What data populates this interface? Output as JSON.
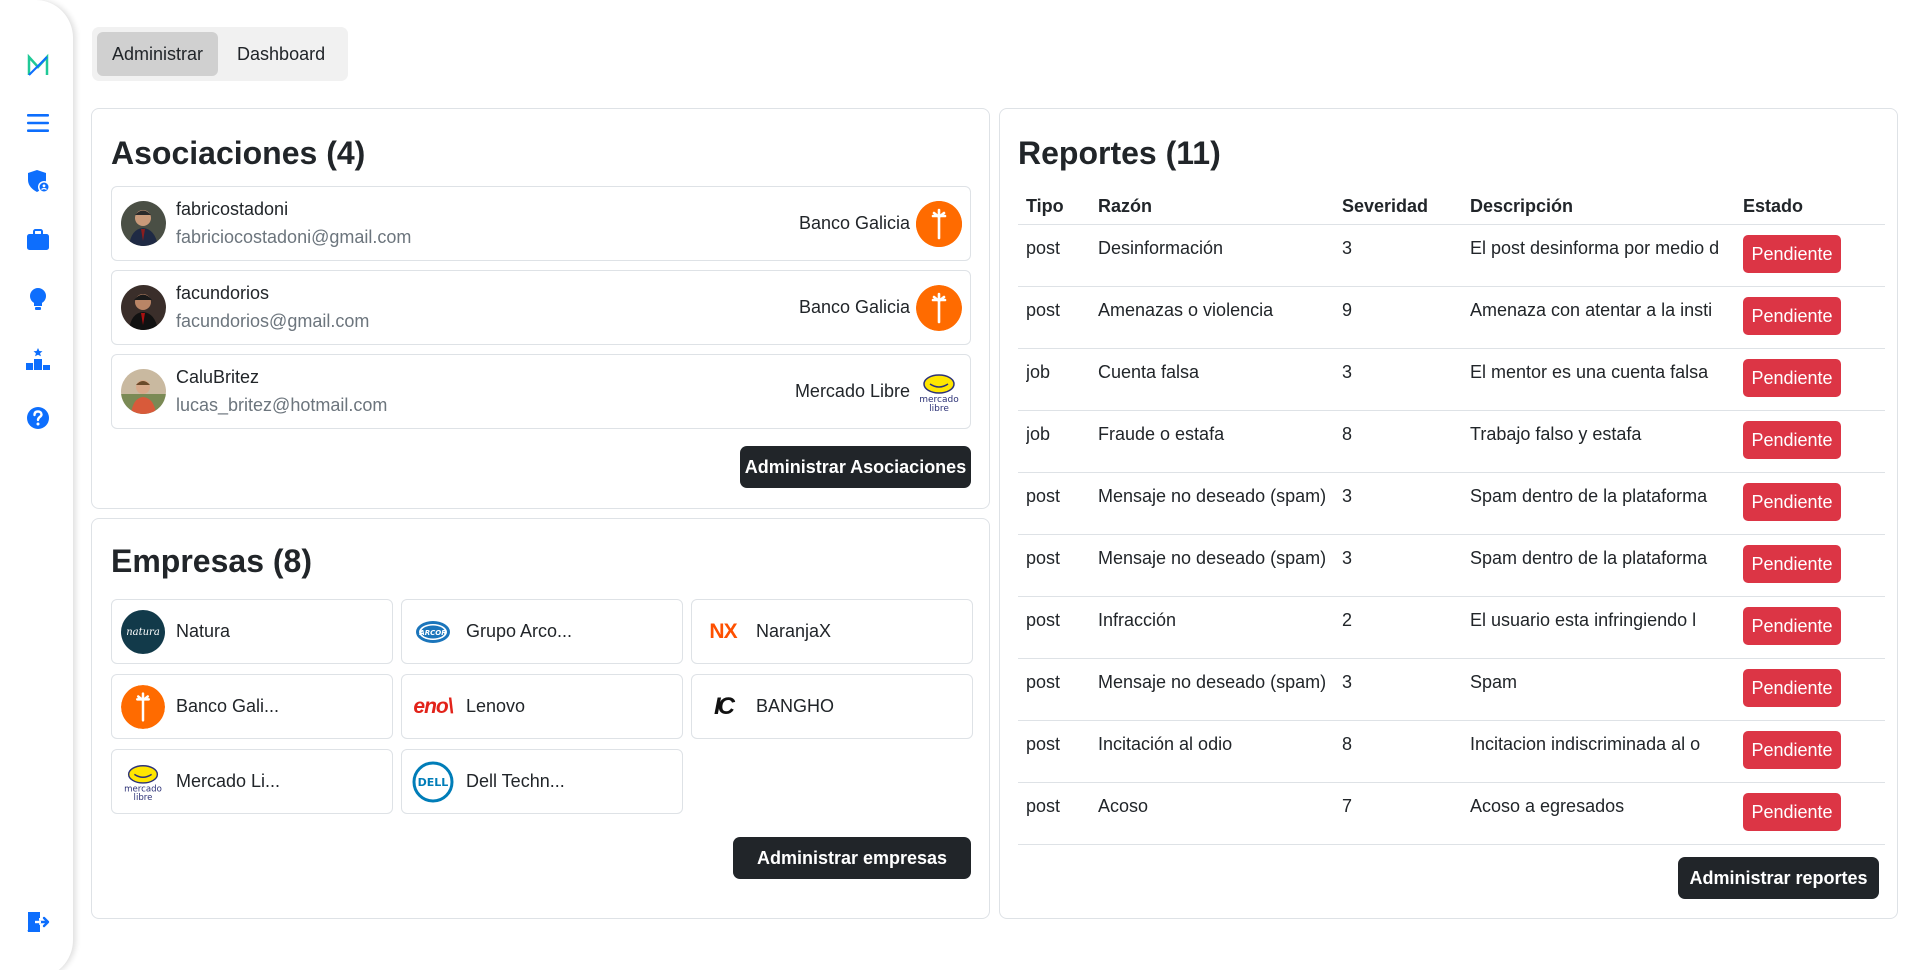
{
  "sidebar": {
    "icons": [
      "logo-icon",
      "menu-icon",
      "shield-user-icon",
      "briefcase-icon",
      "lightbulb-icon",
      "podium-icon",
      "help-icon",
      "logout-icon"
    ],
    "accent": "#0d6efd"
  },
  "tabs": [
    {
      "label": "Administrar",
      "active": true
    },
    {
      "label": "Dashboard",
      "active": false
    }
  ],
  "associations": {
    "title": "Asociaciones (4)",
    "items": [
      {
        "name": "fabricostadoni",
        "email": "fabriciocostadoni@gmail.com",
        "company": "Banco Galicia"
      },
      {
        "name": "facundorios",
        "email": "facundorios@gmail.com",
        "company": "Banco Galicia"
      },
      {
        "name": "CaluBritez",
        "email": "lucas_britez@hotmail.com",
        "company": "Mercado Libre"
      }
    ],
    "button": "Administrar Asociaciones"
  },
  "companies": {
    "title": "Empresas (8)",
    "items": [
      {
        "name": "Natura",
        "logo_text": "natura"
      },
      {
        "name": "Grupo Arco...",
        "logo_text": "ARCOR"
      },
      {
        "name": "NaranjaX",
        "logo_text": "NX"
      },
      {
        "name": "Banco Gali...",
        "logo_text": ""
      },
      {
        "name": "Lenovo",
        "logo_text": "eno\\"
      },
      {
        "name": "BANGHO",
        "logo_text": "IC"
      },
      {
        "name": "Mercado Li...",
        "logo_text": "mercado libre"
      },
      {
        "name": "Dell Techn...",
        "logo_text": "DELL"
      }
    ],
    "button": "Administrar empresas"
  },
  "reports": {
    "title": "Reportes (11)",
    "columns": [
      "Tipo",
      "Razón",
      "Severidad",
      "Descripción",
      "Estado"
    ],
    "rows": [
      {
        "tipo": "post",
        "razon": "Desinformación",
        "severidad": "3",
        "descripcion": "El post desinforma por medio d",
        "estado": "Pendiente"
      },
      {
        "tipo": "post",
        "razon": "Amenazas o violencia",
        "severidad": "9",
        "descripcion": "Amenaza con atentar a la insti",
        "estado": "Pendiente"
      },
      {
        "tipo": "job",
        "razon": "Cuenta falsa",
        "severidad": "3",
        "descripcion": "El mentor es una cuenta falsa",
        "estado": "Pendiente"
      },
      {
        "tipo": "job",
        "razon": "Fraude o estafa",
        "severidad": "8",
        "descripcion": "Trabajo falso y estafa",
        "estado": "Pendiente"
      },
      {
        "tipo": "post",
        "razon": "Mensaje no deseado (spam)",
        "severidad": "3",
        "descripcion": "Spam dentro de la plataforma",
        "estado": "Pendiente"
      },
      {
        "tipo": "post",
        "razon": "Mensaje no deseado (spam)",
        "severidad": "3",
        "descripcion": "Spam dentro de la plataforma",
        "estado": "Pendiente"
      },
      {
        "tipo": "post",
        "razon": "Infracción",
        "severidad": "2",
        "descripcion": "El usuario esta infringiendo l",
        "estado": "Pendiente"
      },
      {
        "tipo": "post",
        "razon": "Mensaje no deseado (spam)",
        "severidad": "3",
        "descripcion": "Spam",
        "estado": "Pendiente"
      },
      {
        "tipo": "post",
        "razon": "Incitación al odio",
        "severidad": "8",
        "descripcion": "Incitacion indiscriminada al o",
        "estado": "Pendiente"
      },
      {
        "tipo": "post",
        "razon": "Acoso",
        "severidad": "7",
        "descripcion": "Acoso a egresados",
        "estado": "Pendiente"
      }
    ],
    "button": "Administrar reportes",
    "badge_color": "#dc3545"
  }
}
